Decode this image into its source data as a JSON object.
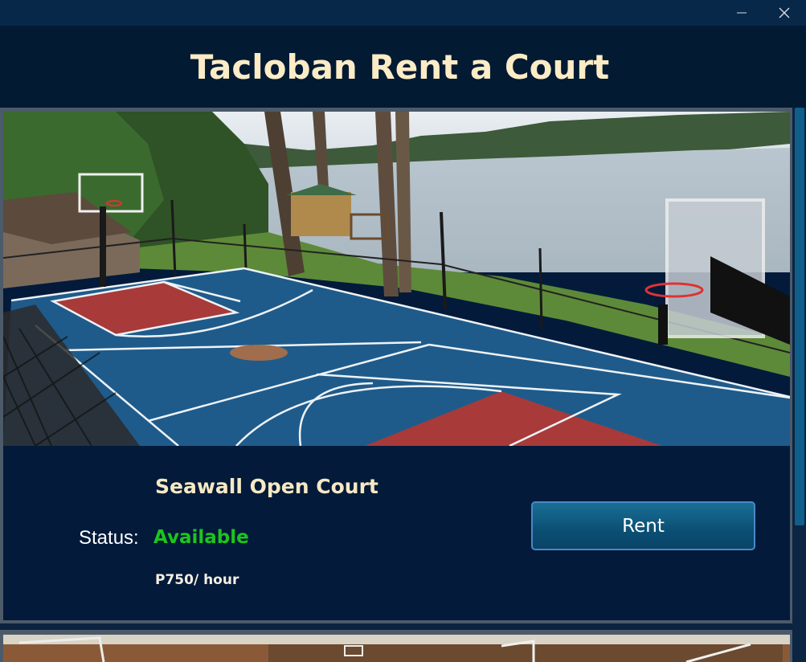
{
  "window": {
    "minimize_glyph": "—",
    "close_glyph": "✕"
  },
  "app": {
    "title": "Tacloban Rent a Court"
  },
  "courts": [
    {
      "name": "Seawall Open Court",
      "status_label": "Status:",
      "status": "Available",
      "price": "P750/ hour",
      "rent_label": "Rent",
      "image": "outdoor-basketball-court-by-lake-photo"
    },
    {
      "image": "indoor-basketball-court-photo"
    }
  ],
  "colors": {
    "title": "#fbecc6",
    "available": "#1dc51d",
    "background": "#041a33",
    "button": "#0b4f74"
  }
}
